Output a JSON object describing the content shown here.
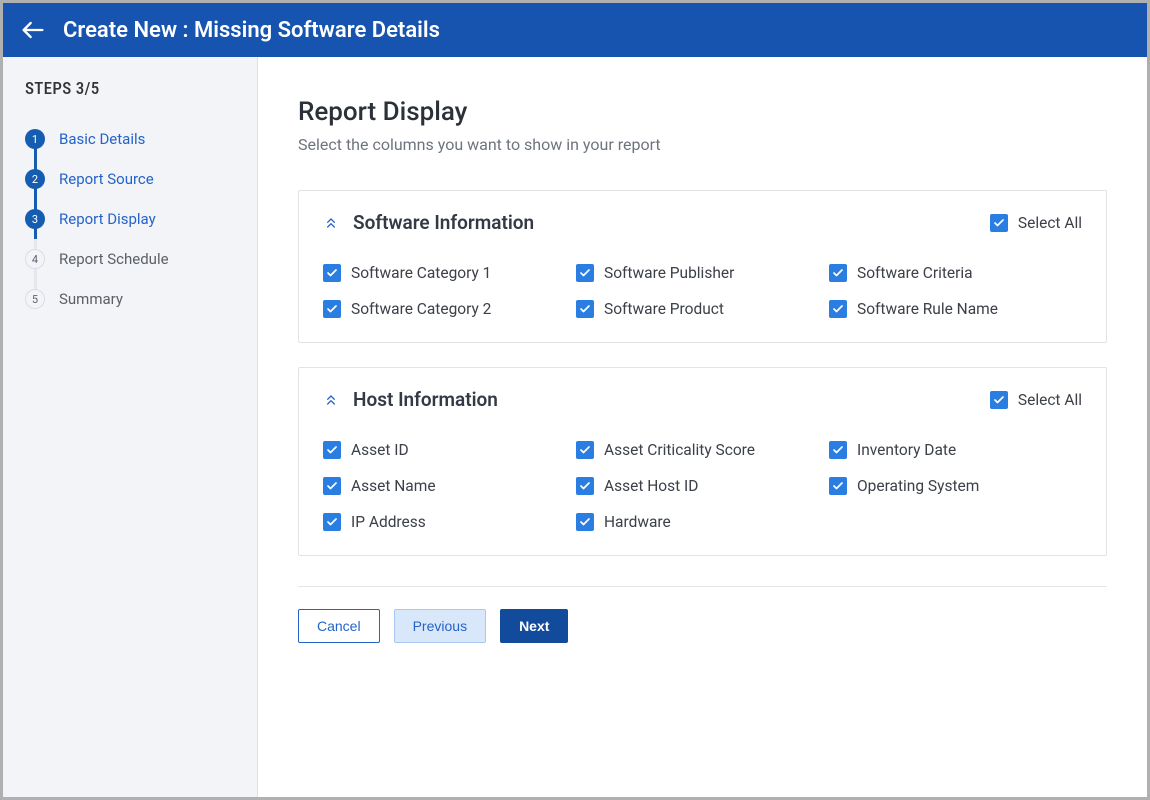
{
  "colors": {
    "primary": "#145db0",
    "checkbox": "#2a7de1",
    "header_bg": "#1654b0"
  },
  "header": {
    "title": "Create New : Missing Software Details"
  },
  "sidebar": {
    "steps_title": "STEPS 3/5",
    "items": [
      {
        "num": "1",
        "label": "Basic Details",
        "state": "done"
      },
      {
        "num": "2",
        "label": "Report Source",
        "state": "done"
      },
      {
        "num": "3",
        "label": "Report Display",
        "state": "active"
      },
      {
        "num": "4",
        "label": "Report Schedule",
        "state": "pending"
      },
      {
        "num": "5",
        "label": "Summary",
        "state": "pending"
      }
    ]
  },
  "page": {
    "title": "Report Display",
    "subtitle": "Select the columns you want to show in your report"
  },
  "sections": [
    {
      "title": "Software Information",
      "select_all_label": "Select All",
      "select_all_checked": true,
      "columns": [
        {
          "label": "Software Category 1",
          "checked": true
        },
        {
          "label": "Software Publisher",
          "checked": true
        },
        {
          "label": "Software Criteria",
          "checked": true
        },
        {
          "label": "Software Category 2",
          "checked": true
        },
        {
          "label": "Software Product",
          "checked": true
        },
        {
          "label": "Software Rule Name",
          "checked": true
        }
      ]
    },
    {
      "title": "Host Information",
      "select_all_label": "Select All",
      "select_all_checked": true,
      "columns": [
        {
          "label": "Asset ID",
          "checked": true
        },
        {
          "label": "Asset Criticality Score",
          "checked": true
        },
        {
          "label": "Inventory Date",
          "checked": true
        },
        {
          "label": "Asset Name",
          "checked": true
        },
        {
          "label": "Asset Host ID",
          "checked": true
        },
        {
          "label": "Operating System",
          "checked": true
        },
        {
          "label": "IP Address",
          "checked": true
        },
        {
          "label": "Hardware",
          "checked": true
        }
      ]
    }
  ],
  "footer": {
    "cancel": "Cancel",
    "previous": "Previous",
    "next": "Next"
  }
}
